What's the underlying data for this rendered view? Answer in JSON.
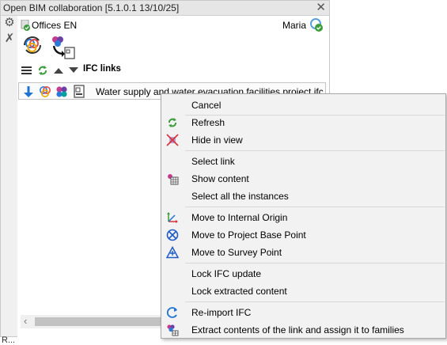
{
  "window": {
    "title": "Open BIM collaboration [5.1.0.1 13/10/25]",
    "close_glyph": "✕"
  },
  "sidebar": {
    "tools": [
      {
        "icon": "gear-icon"
      },
      {
        "icon": "tools-icon"
      }
    ]
  },
  "header": {
    "project": "Offices EN",
    "user": "Maria"
  },
  "toolbar": {
    "label": "IFC links"
  },
  "link": {
    "filename": "Water supply and water evacuation facilities project.ifc"
  },
  "status": {
    "text": "R..."
  },
  "context_menu": {
    "items": [
      {
        "label": "Cancel",
        "icon": ""
      },
      {
        "label": "Refresh",
        "icon": "refresh-icon"
      },
      {
        "label": "Hide in view",
        "icon": "hide-in-view-icon"
      },
      {
        "label": "Select link",
        "icon": ""
      },
      {
        "label": "Show content",
        "icon": "show-content-icon"
      },
      {
        "label": "Select all the instances",
        "icon": ""
      },
      {
        "label": "Move to Internal Origin",
        "icon": "internal-origin-icon"
      },
      {
        "label": "Move to Project Base Point",
        "icon": "project-base-point-icon"
      },
      {
        "label": "Move to Survey Point",
        "icon": "survey-point-icon"
      },
      {
        "label": "Lock IFC update",
        "icon": ""
      },
      {
        "label": "Lock extracted content",
        "icon": ""
      },
      {
        "label": "Re-import IFC",
        "icon": "reimport-icon"
      },
      {
        "label": "Extract contents of the link and assign it to families",
        "icon": "extract-families-icon"
      }
    ]
  },
  "colors": {
    "accent_green": "#4caf50",
    "accent_blue": "#1e73d2",
    "brand_purple": "#7b3fa0"
  }
}
